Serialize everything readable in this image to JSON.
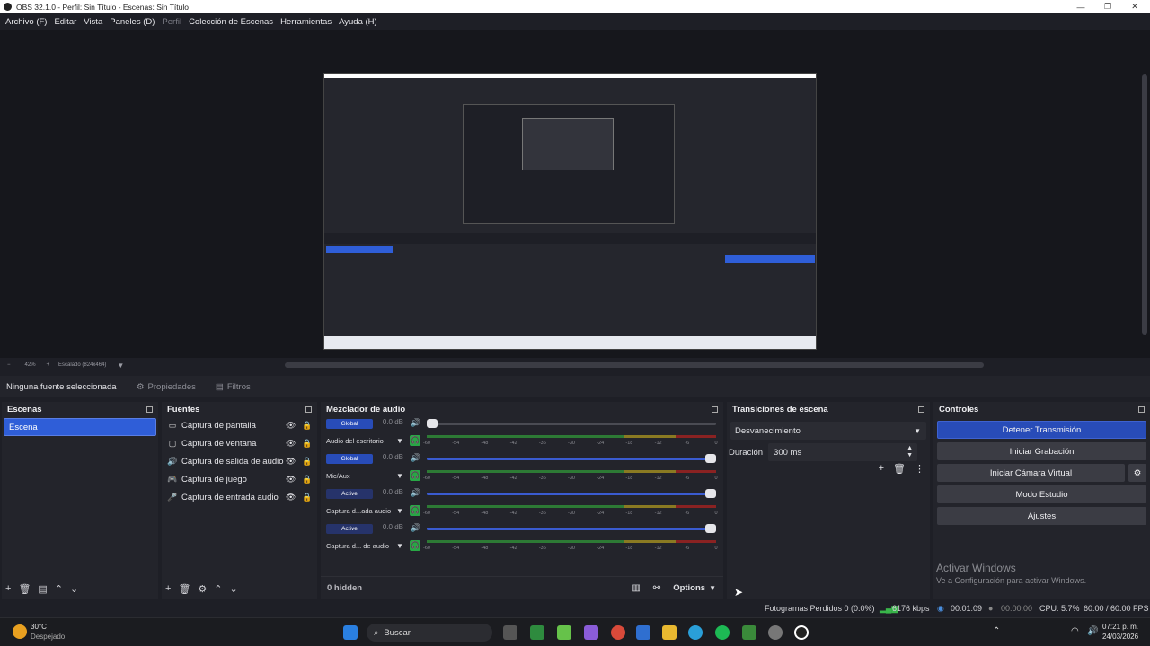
{
  "window": {
    "title": "OBS 32.1.0 - Perfil: Sin Título - Escenas: Sin Título"
  },
  "menu": [
    "Archivo (F)",
    "Editar",
    "Vista",
    "Paneles (D)",
    "Perfil",
    "Colección de Escenas",
    "Herramientas",
    "Ayuda (H)"
  ],
  "zoom": {
    "percent": "42%",
    "scaled": "Escalado (824x464)"
  },
  "source_bar": {
    "none_selected": "Ninguna fuente seleccionada",
    "properties": "Propiedades",
    "filters": "Filtros"
  },
  "scenes": {
    "title": "Escenas",
    "items": [
      "Escena"
    ]
  },
  "sources": {
    "title": "Fuentes",
    "items": [
      {
        "label": "Captura de pantalla",
        "icon": "monitor-icon"
      },
      {
        "label": "Captura de ventana",
        "icon": "window-icon"
      },
      {
        "label": "Captura de salida de audio",
        "icon": "speaker-icon"
      },
      {
        "label": "Captura de juego",
        "icon": "gamepad-icon"
      },
      {
        "label": "Captura de entrada audio",
        "icon": "microphone-icon"
      }
    ]
  },
  "mixer": {
    "title": "Mezclador de audio",
    "hidden": "0 hidden",
    "options": "Options",
    "ticks": [
      "-60",
      "-54",
      "-48",
      "-42",
      "-36",
      "-30",
      "-24",
      "-18",
      "-12",
      "-6",
      "0"
    ],
    "channels": [
      {
        "badge": "Global",
        "name": "Audio del escritorio",
        "db": "0.0 dB",
        "level": 0.0
      },
      {
        "badge": "Global",
        "name": "Mic/Aux",
        "db": "0.0 dB",
        "level": 1.0
      },
      {
        "badge": "Active",
        "name": "Captura d...ada audio",
        "db": "0.0 dB",
        "level": 1.0
      },
      {
        "badge": "Active",
        "name": "Captura d... de audio",
        "db": "0.0 dB",
        "level": 1.0
      }
    ]
  },
  "transitions": {
    "title": "Transiciones de escena",
    "selected": "Desvanecimiento",
    "duration_label": "Duración",
    "duration_value": "300 ms"
  },
  "controls": {
    "title": "Controles",
    "stop_stream": "Detener Transmisión",
    "start_recording": "Iniciar Grabación",
    "start_virtual_cam": "Iniciar Cámara Virtual",
    "studio_mode": "Modo Estudio",
    "settings": "Ajustes"
  },
  "watermark": {
    "line1": "Activar Windows",
    "line2": "Ve a Configuración para activar Windows."
  },
  "status": {
    "dropped": "Fotogramas Perdidos 0 (0.0%)",
    "bitrate": "6176 kbps",
    "stream_time": "00:01:09",
    "rec_time": "00:00:00",
    "cpu": "CPU: 5.7%",
    "fps": "60.00 / 60.00 FPS"
  },
  "taskbar": {
    "temp": "30°C",
    "weather": "Despejado",
    "search": "Buscar",
    "time": "07:21 p. m.",
    "date": "24/03/2026"
  },
  "colors": {
    "accent": "#2f5ed8",
    "bg": "#1e1f26",
    "panel": "#23242b"
  }
}
